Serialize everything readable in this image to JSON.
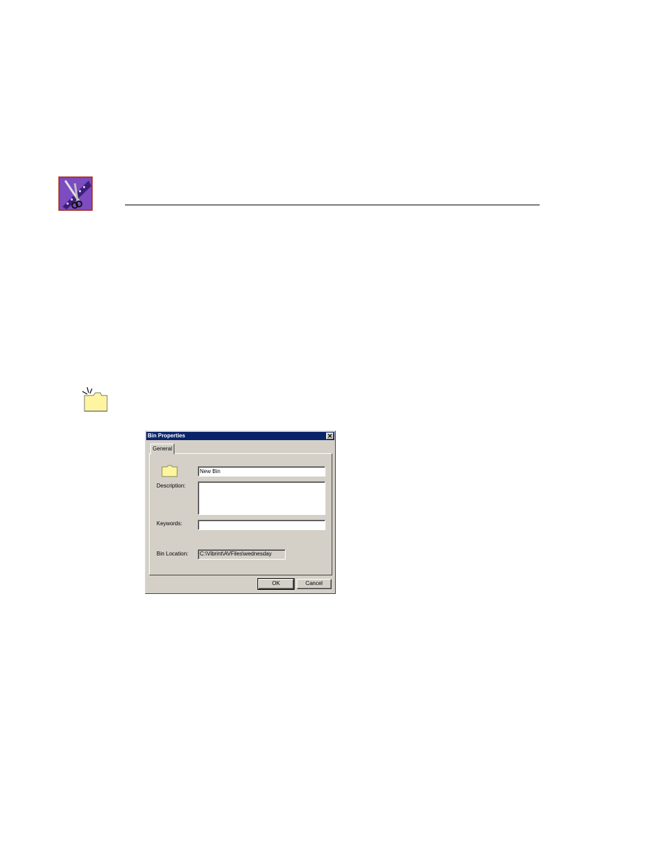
{
  "dialog": {
    "title": "Bin Properties",
    "close_glyph": "✕",
    "tab_general": "General",
    "name_value": "New Bin",
    "description_label": "Description:",
    "description_value": "",
    "keywords_label": "Keywords:",
    "keywords_value": "",
    "location_label": "Bin Location:",
    "location_value": "C:\\Vibrint\\AVFiles\\wednesday",
    "ok_label": "OK",
    "cancel_label": "Cancel"
  },
  "colors": {
    "titlebar": "#0a246a",
    "dialog_face": "#d4d0c8",
    "folder": "#fff5a0"
  },
  "icons": {
    "logo": "film-scissors-logo-icon",
    "note": "note-folder-icon",
    "bin": "folder-icon"
  }
}
